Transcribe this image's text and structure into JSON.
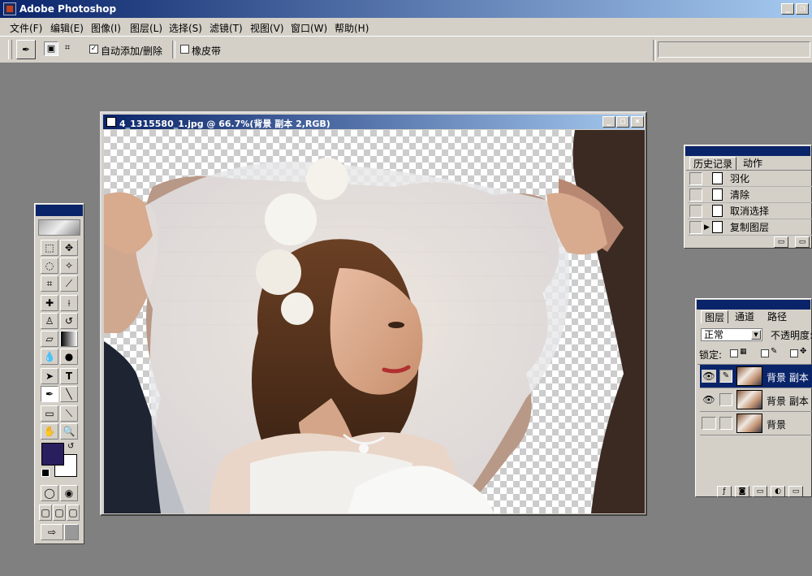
{
  "app": {
    "title": "Adobe Photoshop"
  },
  "menu": [
    "文件(F)",
    "编辑(E)",
    "图像(I)",
    "图层(L)",
    "选择(S)",
    "滤镜(T)",
    "视图(V)",
    "窗口(W)",
    "帮助(H)"
  ],
  "options": {
    "auto_add_delete_label": "自动添加/删除",
    "auto_add_delete_checked": true,
    "rubber_band_label": "橡皮带",
    "rubber_band_checked": false
  },
  "document": {
    "title": "4_1315580_1.jpg @ 66.7%(背景 副本 2,RGB)"
  },
  "colors": {
    "foreground": "#2a1f5e",
    "background": "#ffffff",
    "title_bar": "#0a246a"
  },
  "toolbox": {
    "tools": [
      "marquee-icon",
      "move-icon",
      "lasso-icon",
      "magic-wand-icon",
      "crop-icon",
      "slice-icon",
      "healing-brush-icon",
      "brush-icon",
      "clone-stamp-icon",
      "history-brush-icon",
      "eraser-icon",
      "gradient-icon",
      "blur-icon",
      "dodge-icon",
      "path-select-icon",
      "type-icon",
      "pen-icon",
      "line-icon",
      "notes-icon",
      "eyedropper-icon",
      "hand-icon",
      "zoom-icon"
    ]
  },
  "history_panel": {
    "tabs": [
      "历史记录",
      "动作"
    ],
    "items": [
      "羽化",
      "清除",
      "取消选择",
      "复制图层"
    ]
  },
  "layers_panel": {
    "tabs": [
      "图层",
      "通道",
      "路径"
    ],
    "blend_mode": "正常",
    "opacity_label": "不透明度:",
    "lock_label": "锁定:",
    "layers": [
      {
        "name": "背景 副本",
        "visible": true,
        "selected": true
      },
      {
        "name": "背景 副本",
        "visible": true,
        "selected": false
      },
      {
        "name": "背景",
        "visible": false,
        "selected": false
      }
    ]
  }
}
